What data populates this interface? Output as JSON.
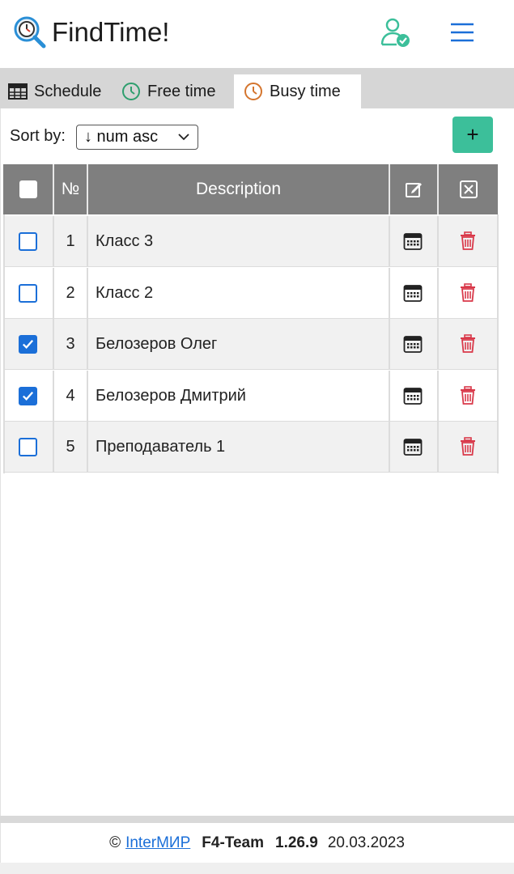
{
  "header": {
    "title": "FindTime!",
    "icons": {
      "logo": "clock-search-icon",
      "user": "user-check-icon",
      "menu": "hamburger-icon"
    },
    "colors": {
      "accent": "#3cbf9a"
    }
  },
  "tabs": [
    {
      "label": "Schedule",
      "icon": "table-icon",
      "active": false
    },
    {
      "label": "Free time",
      "icon": "clock-icon",
      "active": false
    },
    {
      "label": "Busy time",
      "icon": "clock-icon",
      "active": true
    }
  ],
  "sort": {
    "label": "Sort by:",
    "value": "↓ num asc"
  },
  "add_button": {
    "label": "+"
  },
  "table": {
    "columns": {
      "num": "№",
      "description": "Description"
    },
    "rows": [
      {
        "num": "1",
        "description": "Класс 3",
        "checked": false
      },
      {
        "num": "2",
        "description": "Класс 2",
        "checked": false
      },
      {
        "num": "3",
        "description": "Белозеров Олег",
        "checked": true
      },
      {
        "num": "4",
        "description": "Белозеров Дмитрий",
        "checked": true
      },
      {
        "num": "5",
        "description": "Преподаватель 1",
        "checked": false
      }
    ]
  },
  "footer": {
    "copyright": "©",
    "link": "InterМИР",
    "team": "F4-Team",
    "version": "1.26.9",
    "date": "20.03.2023"
  }
}
